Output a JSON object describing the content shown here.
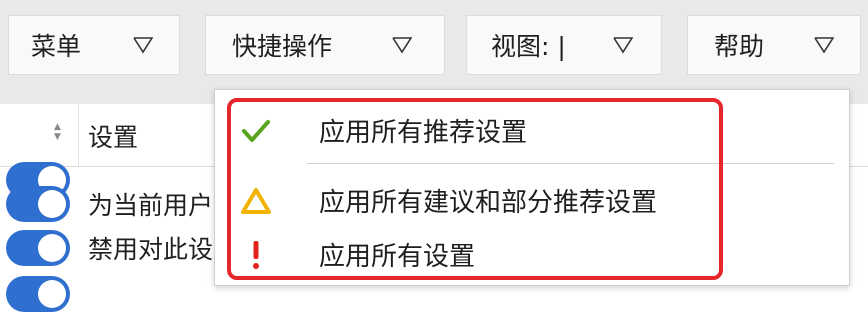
{
  "toolbar": {
    "buttons": [
      {
        "label": "菜单",
        "icon": "chevron-down-icon"
      },
      {
        "label": "快捷操作",
        "icon": "chevron-down-icon"
      },
      {
        "label": "视图: |",
        "icon": "chevron-down-icon"
      },
      {
        "label": "帮助",
        "icon": "chevron-down-icon"
      }
    ]
  },
  "table": {
    "header_label": "设置",
    "sort_icon": "sort-icon",
    "rows": [
      {
        "label": "为当前用户",
        "toggle": "on"
      },
      {
        "label": "禁用对此设",
        "toggle": "on"
      }
    ]
  },
  "dropdown_menu": {
    "items": [
      {
        "label": "应用所有推荐设置",
        "icon": "check-icon",
        "icon_color": "#5aa520"
      },
      {
        "label": "应用所有建议和部分推荐设置",
        "icon": "warning-triangle-icon",
        "icon_color": "#f0b400"
      },
      {
        "label": "应用所有设置",
        "icon": "exclamation-icon",
        "icon_color": "#e2231a"
      }
    ],
    "highlight_color": "#e5262b"
  },
  "colors": {
    "toggle_on": "#2f6fcf",
    "toolbar_bg": "#e9e9e9"
  }
}
